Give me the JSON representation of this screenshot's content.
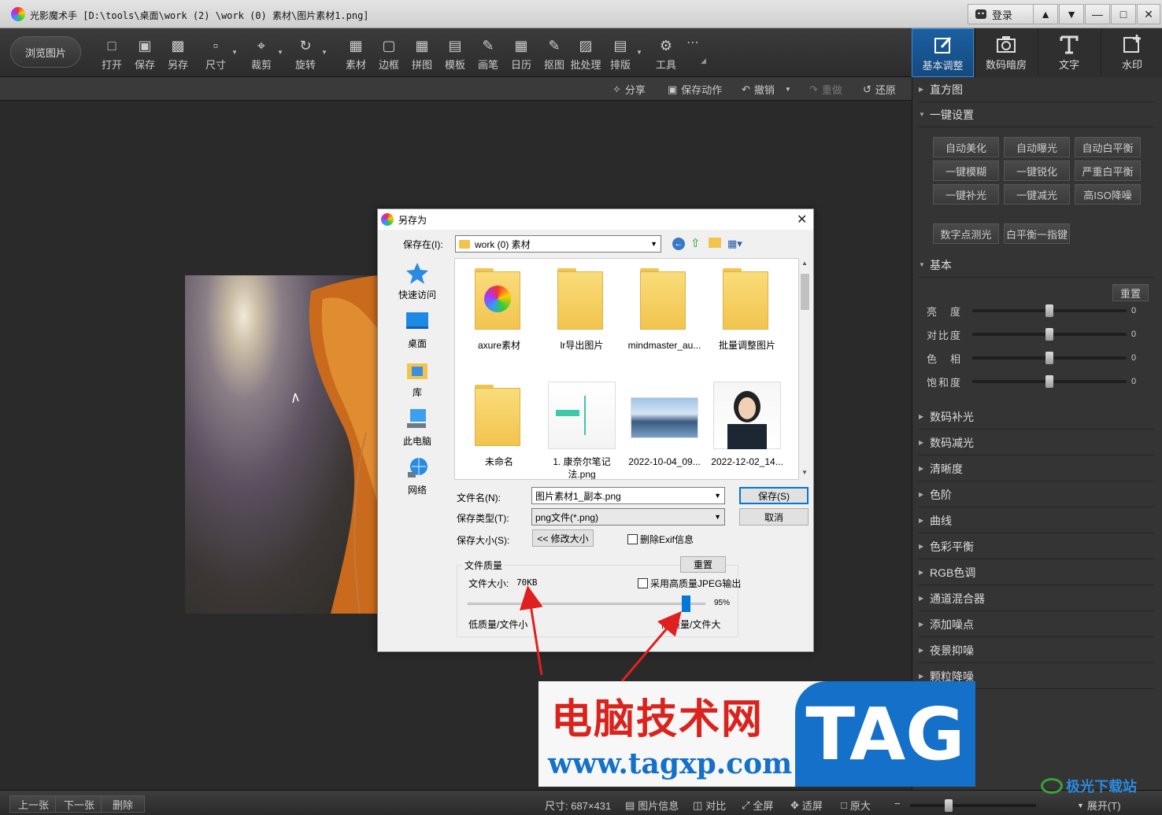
{
  "window": {
    "title": "光影魔术手  [D:\\tools\\桌面\\work (2) \\work (0) 素材\\图片素材1.png]",
    "login_label": "登录"
  },
  "toolbar": {
    "browse_label": "浏览图片",
    "tools": [
      {
        "label": "打开",
        "icon": "open-icon"
      },
      {
        "label": "保存",
        "icon": "save-icon"
      },
      {
        "label": "另存",
        "icon": "save-as-icon"
      },
      {
        "label": "尺寸",
        "icon": "resize-icon"
      },
      {
        "label": "裁剪",
        "icon": "crop-icon"
      },
      {
        "label": "旋转",
        "icon": "rotate-icon"
      },
      {
        "label": "素材",
        "icon": "material-icon"
      },
      {
        "label": "边框",
        "icon": "border-icon"
      },
      {
        "label": "拼图",
        "icon": "collage-icon"
      },
      {
        "label": "模板",
        "icon": "template-icon"
      },
      {
        "label": "画笔",
        "icon": "brush-icon"
      },
      {
        "label": "日历",
        "icon": "calendar-icon"
      },
      {
        "label": "抠图",
        "icon": "cutout-icon"
      },
      {
        "label": "批处理",
        "icon": "batch-icon"
      },
      {
        "label": "排版",
        "icon": "layout-icon"
      },
      {
        "label": "工具",
        "icon": "wrench-icon"
      }
    ]
  },
  "right_tabs": [
    {
      "label": "基本调整",
      "active": true
    },
    {
      "label": "数码暗房",
      "active": false
    },
    {
      "label": "文字",
      "active": false
    },
    {
      "label": "水印",
      "active": false
    }
  ],
  "subtoolbar": {
    "share": "分享",
    "save_action": "保存动作",
    "undo": "撤销",
    "redo": "重做",
    "restore": "还原"
  },
  "right_panel": {
    "histogram": "直方图",
    "oneclick": "一键设置",
    "oneclick_buttons": [
      "自动美化",
      "自动曝光",
      "自动白平衡",
      "一键模糊",
      "一键锐化",
      "严重白平衡",
      "一键补光",
      "一键减光",
      "高ISO降噪"
    ],
    "extra_buttons": [
      "数字点测光",
      "白平衡一指键"
    ],
    "basic": "基本",
    "reset": "重置",
    "sliders": [
      {
        "label": "亮　度",
        "value": "0",
        "level": 0.5
      },
      {
        "label": "对比度",
        "value": "0",
        "level": 0.5
      },
      {
        "label": "色　相",
        "value": "0",
        "level": 0.5
      },
      {
        "label": "饱和度",
        "value": "0",
        "level": 0.5
      }
    ],
    "sections": [
      "数码补光",
      "数码减光",
      "清晰度",
      "色阶",
      "曲线",
      "色彩平衡",
      "RGB色调",
      "通道混合器",
      "添加噪点",
      "夜景抑噪",
      "颗粒降噪"
    ]
  },
  "dialog": {
    "title": "另存为",
    "save_in_label": "保存在(I):",
    "save_in_value": "work (0) 素材",
    "places": [
      "快速访问",
      "桌面",
      "库",
      "此电脑",
      "网络"
    ],
    "files": [
      {
        "name": "axure素材",
        "kind": "folder"
      },
      {
        "name": "lr导出图片",
        "kind": "folder"
      },
      {
        "name": "mindmaster_au...",
        "kind": "folder"
      },
      {
        "name": "批量调整图片",
        "kind": "folder"
      },
      {
        "name": "未命名",
        "kind": "folder"
      },
      {
        "name": "1. 康奈尔笔记法.png",
        "kind": "image"
      },
      {
        "name": "2022-10-04_09...",
        "kind": "image"
      },
      {
        "name": "2022-12-02_14...",
        "kind": "image"
      }
    ],
    "filename_label": "文件名(N):",
    "filename_value": "图片素材1_副本.png",
    "filetype_label": "保存类型(T):",
    "filetype_value": "png文件(*.png)",
    "size_label": "保存大小(S):",
    "resize_button": "<< 修改大小",
    "exif_label": "删除Exif信息",
    "save_button": "保存(S)",
    "cancel_button": "取消",
    "quality_group": "文件质量",
    "quality_reset": "重置",
    "file_size_label": "文件大小:",
    "file_size_value": "70KB",
    "jpeg_label": "采用高质量JPEG输出",
    "quality_percent": "95%",
    "quality_level": 0.95,
    "low_label": "低质量/文件小",
    "high_label": "高质量/文件大"
  },
  "status": {
    "prev": "上一张",
    "next": "下一张",
    "delete": "删除",
    "size": "尺寸: 687×431",
    "info": "图片信息",
    "compare": "对比",
    "fullscreen": "全屏",
    "fit": "适屏",
    "original": "原大",
    "expand": "展开(T)"
  },
  "watermark": {
    "cn": "电脑技术网",
    "url": "www.tagxp.com",
    "tag": "TAG",
    "corner": "极光下载站"
  },
  "colors": {
    "accent": "#1c5fa0",
    "wm_red": "#d9231c",
    "wm_blue": "#1470c8",
    "arrow": "#e02020"
  }
}
